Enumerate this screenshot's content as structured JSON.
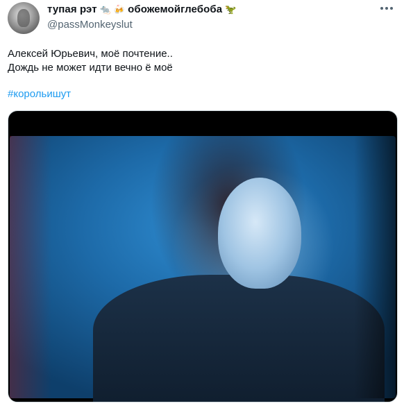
{
  "tweet": {
    "display_name": "тупая рэт",
    "display_name_extra": "обожемойглебоба",
    "emojis": [
      "rat-emoji",
      "beer-emoji",
      "dinosaur-emoji"
    ],
    "handle": "@passMonkeyslut",
    "text_line1": "Алексей Юрьевич, моё почтение..",
    "text_line2": "Дождь не может идти вечно ё моё",
    "hashtag": "#корольишут"
  }
}
